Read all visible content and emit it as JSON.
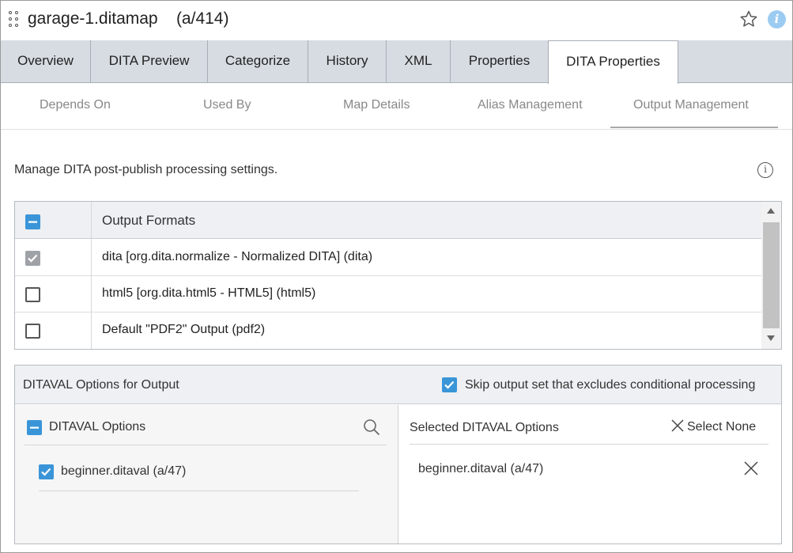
{
  "window": {
    "title": "garage-1.ditamap    (a/414)",
    "icons": [
      "drag-handle-icon",
      "star-icon",
      "info-icon"
    ]
  },
  "tabs": [
    {
      "label": "Overview",
      "active": false
    },
    {
      "label": "DITA Preview",
      "active": false
    },
    {
      "label": "Categorize",
      "active": false
    },
    {
      "label": "History",
      "active": false
    },
    {
      "label": "XML",
      "active": false
    },
    {
      "label": "Properties",
      "active": false
    },
    {
      "label": "DITA Properties",
      "active": true
    }
  ],
  "subtabs": [
    {
      "label": "Depends On",
      "active": false
    },
    {
      "label": "Used By",
      "active": false
    },
    {
      "label": "Map Details",
      "active": false
    },
    {
      "label": "Alias Management",
      "active": false
    },
    {
      "label": "Output Management",
      "active": true
    }
  ],
  "description": "Manage DITA post-publish processing settings.",
  "output_formats": {
    "header": "Output Formats",
    "header_checkbox_state": "partial",
    "rows": [
      {
        "label": "dita [org.dita.normalize - Normalized DITA] (dita)",
        "checked": true,
        "disabled": true
      },
      {
        "label": "html5 [org.dita.html5 - HTML5] (html5)",
        "checked": false,
        "disabled": false
      },
      {
        "label": "Default \"PDF2\" Output (pdf2)",
        "checked": false,
        "disabled": false
      }
    ]
  },
  "ditaval": {
    "panel_title": "DITAVAL Options for Output",
    "skip_label": "Skip output set that excludes conditional processing",
    "skip_checked": true,
    "options_title": "DITAVAL Options",
    "options": [
      {
        "label": "beginner.ditaval (a/47)",
        "checked": true
      }
    ],
    "selected_title": "Selected DITAVAL Options",
    "select_none_label": "Select None",
    "selected": [
      {
        "label": "beginner.ditaval (a/47)"
      }
    ]
  },
  "colors": {
    "accent": "#3a95d8",
    "tab_bar": "#d7dce2",
    "header_bg": "#eef0f3"
  }
}
